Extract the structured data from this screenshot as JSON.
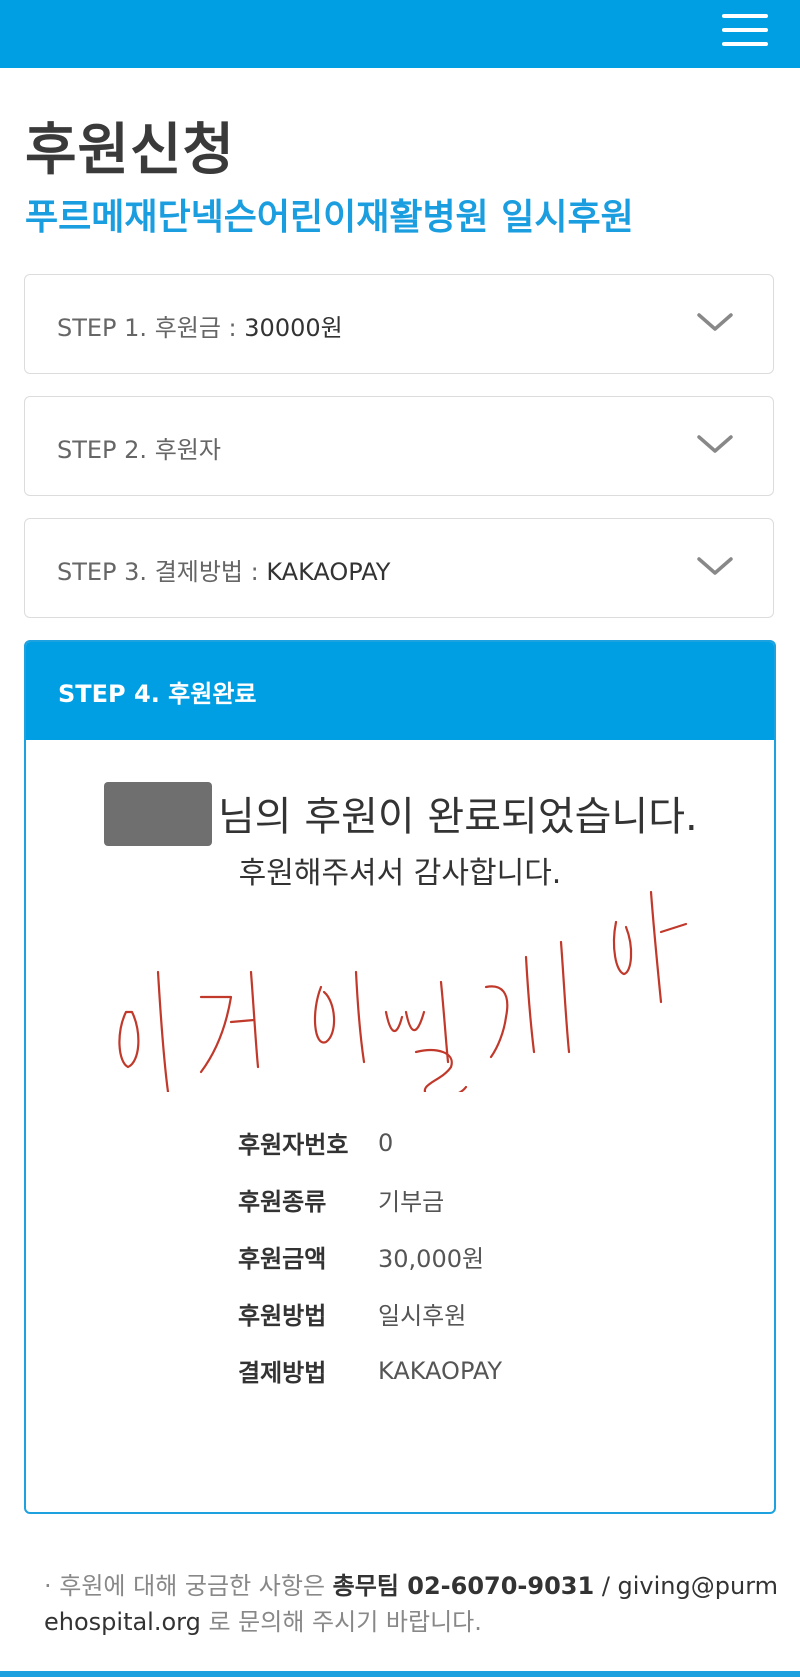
{
  "header": {
    "menu_icon": "hamburger-menu-icon",
    "color": "#009fe3"
  },
  "page": {
    "title": "후원신청",
    "subtitle": "푸르메재단넥슨어린이재활병원 일시후원"
  },
  "steps": [
    {
      "label": "STEP 1. 후원금 : ",
      "value": "30000원",
      "icon": "chevron-down-icon"
    },
    {
      "label": "STEP 2. 후원자",
      "value": "",
      "icon": "chevron-down-icon"
    },
    {
      "label": "STEP 3. 결제방법 : ",
      "value": "KAKAOPAY",
      "icon": "chevron-down-icon"
    }
  ],
  "step4": {
    "label": "STEP 4. 후원완료",
    "completion_message": "님의 후원이 완료되었습니다.",
    "thanks": "후원해주셔서 감사합니다.",
    "scribble_color": "#c0392b",
    "details": [
      {
        "label": "후원자번호",
        "value": "0"
      },
      {
        "label": "후원종류",
        "value": "기부금"
      },
      {
        "label": "후원금액",
        "value": "30,000원"
      },
      {
        "label": "후원방법",
        "value": "일시후원"
      },
      {
        "label": "결제방법",
        "value": "KAKAOPAY"
      }
    ]
  },
  "footer": {
    "prefix": "· 후원에 대해 궁금한 사항은 ",
    "team": "총무팀",
    "phone": " 02-6070-9031",
    "sep": " / ",
    "email": "giving@purmehospital.org",
    "suffix": " 로 문의해 주시기 바랍니다."
  },
  "accent_color": "#1ea2df"
}
